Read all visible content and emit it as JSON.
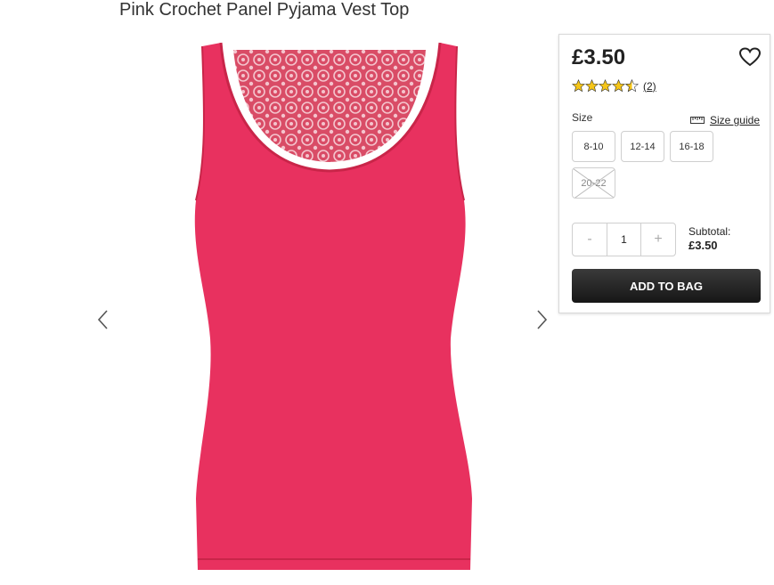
{
  "product": {
    "title": "Pink Crochet Panel Pyjama Vest Top",
    "price": "£3.50",
    "rating_value": 4.5,
    "rating_max": 5,
    "review_count": "(2)",
    "product_color": "#e8315f"
  },
  "gallery": {
    "prev_icon": "chevron-left-icon",
    "next_icon": "chevron-right-icon"
  },
  "wishlist": {
    "icon": "heart-outline-icon"
  },
  "size": {
    "label": "Size",
    "guide_label": "Size guide",
    "guide_icon": "ruler-icon",
    "options": [
      {
        "label": "8-10",
        "available": true
      },
      {
        "label": "12-14",
        "available": true
      },
      {
        "label": "16-18",
        "available": true
      },
      {
        "label": "20-22",
        "available": false
      }
    ]
  },
  "quantity": {
    "minus": "-",
    "value": "1",
    "plus": "+"
  },
  "subtotal": {
    "label": "Subtotal:",
    "amount": "£3.50"
  },
  "cart": {
    "add_label": "ADD TO BAG"
  },
  "colors": {
    "star": "#f5c518",
    "button_dark": "#222222"
  }
}
